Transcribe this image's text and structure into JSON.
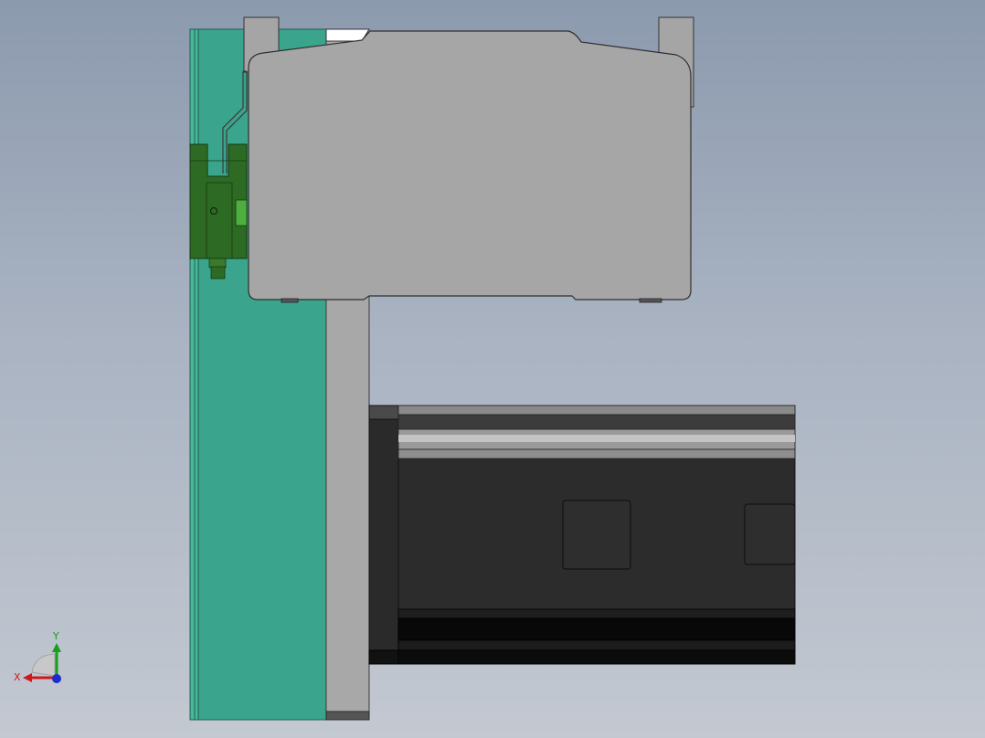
{
  "viewport": {
    "background_top": "#8c9aae",
    "background_bottom": "#c3c8d1"
  },
  "model": {
    "components": [
      "mounting-plate",
      "carriage-bracket",
      "slide-block",
      "sensor-bracket",
      "stepper-motor"
    ],
    "colors": {
      "mounting_plate": "#3aa58c",
      "gray_parts": "#a5a5a5",
      "sensor": "#2d6a23",
      "motor_body": "#2c2c2c"
    }
  },
  "triad": {
    "x_label": "X",
    "y_label": "Y",
    "x_color": "#d01818",
    "y_color": "#18a018",
    "z_color": "#1a2ccc"
  }
}
